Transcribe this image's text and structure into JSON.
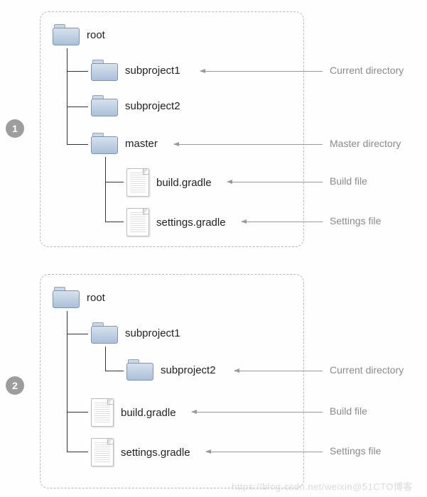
{
  "diagrams": [
    {
      "badge": "1",
      "nodes": {
        "root": {
          "type": "folder",
          "label": "root"
        },
        "sub1": {
          "type": "folder",
          "label": "subproject1",
          "annotation": "Current directory"
        },
        "sub2": {
          "type": "folder",
          "label": "subproject2"
        },
        "master": {
          "type": "folder",
          "label": "master",
          "annotation": "Master directory"
        },
        "build": {
          "type": "file",
          "label": "build.gradle",
          "annotation": "Build file"
        },
        "settings": {
          "type": "file",
          "label": "settings.gradle",
          "annotation": "Settings file"
        }
      }
    },
    {
      "badge": "2",
      "nodes": {
        "root": {
          "type": "folder",
          "label": "root"
        },
        "sub1": {
          "type": "folder",
          "label": "subproject1"
        },
        "sub2": {
          "type": "folder",
          "label": "subproject2",
          "annotation": "Current directory"
        },
        "build": {
          "type": "file",
          "label": "build.gradle",
          "annotation": "Build file"
        },
        "settings": {
          "type": "file",
          "label": "settings.gradle",
          "annotation": "Settings file"
        }
      }
    }
  ],
  "watermark": "https://blog.csdn.net/weixin@51CTO博客"
}
